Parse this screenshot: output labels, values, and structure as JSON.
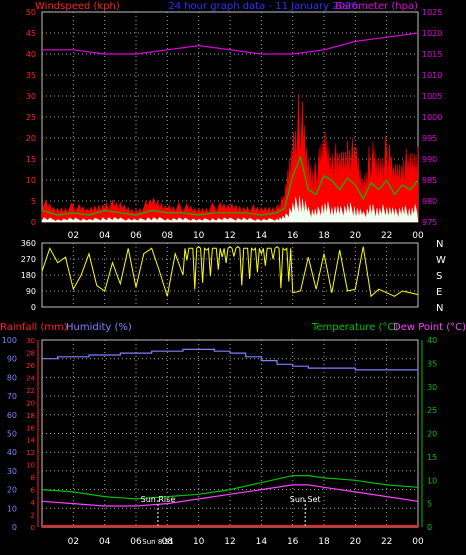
{
  "header": {
    "left_label": "Windspeed (kph)",
    "title": "24 hour graph data - 11 January 2026",
    "right_label": "Barometer (hpa)"
  },
  "colors": {
    "background": "#000000",
    "frame": "#c0c0c0",
    "grid": "#a0a0a0",
    "windspeed_label": "#ff2020",
    "title": "#3030ff",
    "barometer": "#e000e0",
    "gust": "#ff0000",
    "avg_wind": "#00c000",
    "wind_min": "#f0fff0",
    "direction": "#ffff00",
    "humidity": "#8080ff",
    "rainfall": "#ff2020",
    "temperature": "#00c000",
    "dewpoint": "#ff40ff",
    "axis_green": "#00c000",
    "text_white": "#ffffff"
  },
  "time_ticks": [
    "02",
    "04",
    "06",
    "08",
    "10",
    "12",
    "14",
    "16",
    "18",
    "20",
    "22",
    "00"
  ],
  "panel1": {
    "left_ticks": [
      0,
      5,
      10,
      15,
      20,
      25,
      30,
      35,
      40,
      45,
      50
    ],
    "right_ticks": [
      975,
      980,
      985,
      990,
      995,
      1000,
      1005,
      1010,
      1015,
      1020,
      1025
    ]
  },
  "panel2": {
    "left_ticks": [
      0,
      90,
      180,
      270,
      360
    ],
    "compass": [
      "N",
      "W",
      "S",
      "E",
      "N"
    ]
  },
  "panel3": {
    "header_left_a": "Rainfall (mm)",
    "header_left_b": "Humidity (%)",
    "header_right_a": "Temperature (°C)",
    "header_right_b": "Dew Point (°C)",
    "humidity_ticks": [
      0,
      10,
      20,
      30,
      40,
      50,
      60,
      70,
      80,
      90,
      100
    ],
    "rain_ticks": [
      0,
      2,
      4,
      6,
      8,
      10,
      12,
      14,
      16,
      18,
      20,
      22,
      24,
      26,
      28,
      30
    ],
    "temp_ticks": [
      0,
      5,
      10,
      15,
      20,
      25,
      30,
      35,
      40
    ],
    "sunrise_label": "Sun Rise",
    "sunset_label": "Sun Set",
    "sunrise_time": "Sun 8:51"
  },
  "chart_data": [
    {
      "type": "line",
      "x_unit": "hours",
      "xlim": [
        0,
        24
      ],
      "series": [
        {
          "name": "Windspeed (kph)",
          "axis": "left",
          "ylim": [
            0,
            50
          ],
          "x": [
            0,
            1,
            2,
            3,
            4,
            5,
            6,
            7,
            8,
            9,
            10,
            11,
            12,
            13,
            14,
            15,
            15.5,
            16,
            16.5,
            17,
            17.5,
            18,
            18.5,
            19,
            19.5,
            20,
            20.5,
            21,
            21.5,
            22,
            22.5,
            23,
            23.5,
            24
          ],
          "values": [
            5,
            3,
            4,
            3,
            5,
            4,
            3,
            5,
            4,
            4,
            3,
            4,
            4,
            4,
            3,
            4,
            6,
            20,
            28,
            14,
            12,
            20,
            18,
            14,
            19,
            16,
            10,
            17,
            14,
            18,
            12,
            16,
            14,
            18
          ]
        },
        {
          "name": "Barometer (hpa)",
          "axis": "right",
          "ylim": [
            975,
            1025
          ],
          "x": [
            0,
            2,
            4,
            6,
            8,
            10,
            12,
            14,
            16,
            18,
            20,
            22,
            24
          ],
          "values": [
            1016,
            1016,
            1015,
            1015,
            1016,
            1017,
            1016,
            1015,
            1015,
            1016,
            1018,
            1019,
            1020
          ]
        }
      ]
    },
    {
      "type": "line",
      "x_unit": "hours",
      "xlim": [
        0,
        24
      ],
      "ylim": [
        0,
        360
      ],
      "series": [
        {
          "name": "Wind direction",
          "x": [
            0,
            0.5,
            1,
            1.5,
            2,
            2.5,
            3,
            3.5,
            4,
            4.5,
            5,
            5.5,
            6,
            6.5,
            7,
            7.5,
            8,
            8.5,
            9,
            9.5,
            10,
            10.5,
            11,
            11.5,
            12,
            12.5,
            13,
            13.5,
            14,
            14.5,
            15,
            15.5,
            16,
            16.5,
            17,
            17.5,
            18,
            18.5,
            19,
            19.5,
            20,
            20.5,
            21,
            21.5,
            22,
            22.5,
            23,
            23.5,
            24
          ],
          "values": [
            200,
            330,
            250,
            280,
            100,
            180,
            300,
            120,
            90,
            250,
            130,
            330,
            110,
            300,
            330,
            200,
            60,
            300,
            180,
            330,
            340,
            320,
            330,
            280,
            340,
            340,
            330,
            320,
            300,
            330,
            340,
            320,
            80,
            90,
            280,
            100,
            300,
            80,
            320,
            90,
            100,
            340,
            60,
            100,
            80,
            60,
            90,
            80,
            70
          ]
        }
      ]
    },
    {
      "type": "line",
      "x_unit": "hours",
      "xlim": [
        0,
        24
      ],
      "series": [
        {
          "name": "Humidity (%)",
          "axis": "left",
          "ylim": [
            0,
            100
          ],
          "x": [
            0,
            1,
            2,
            3,
            4,
            5,
            6,
            7,
            8,
            9,
            10,
            11,
            12,
            13,
            14,
            15,
            16,
            17,
            18,
            19,
            20,
            21,
            22,
            23,
            24
          ],
          "values": [
            90,
            91,
            91,
            92,
            92,
            93,
            93,
            94,
            94,
            95,
            95,
            94,
            93,
            91,
            89,
            87,
            86,
            85,
            85,
            85,
            84,
            84,
            84,
            84,
            83
          ]
        },
        {
          "name": "Rainfall (mm)",
          "axis": "left2",
          "ylim": [
            0,
            30
          ],
          "x": [
            0,
            24
          ],
          "values": [
            0,
            0
          ]
        },
        {
          "name": "Temperature (°C)",
          "axis": "right",
          "ylim": [
            0,
            40
          ],
          "x": [
            0,
            2,
            4,
            6,
            8,
            10,
            12,
            14,
            16,
            17,
            18,
            20,
            22,
            24
          ],
          "values": [
            8,
            7.5,
            6.5,
            6,
            6.5,
            7,
            8,
            9.5,
            11,
            11,
            10.5,
            10,
            9,
            8.5
          ]
        },
        {
          "name": "Dew Point (°C)",
          "axis": "right",
          "ylim": [
            0,
            40
          ],
          "x": [
            0,
            2,
            4,
            6,
            8,
            10,
            12,
            14,
            16,
            17,
            18,
            20,
            22,
            24
          ],
          "values": [
            5.5,
            5,
            4.5,
            4.5,
            5,
            6,
            7,
            8,
            9,
            9,
            8.5,
            7.5,
            6.5,
            5.5
          ]
        }
      ]
    }
  ]
}
